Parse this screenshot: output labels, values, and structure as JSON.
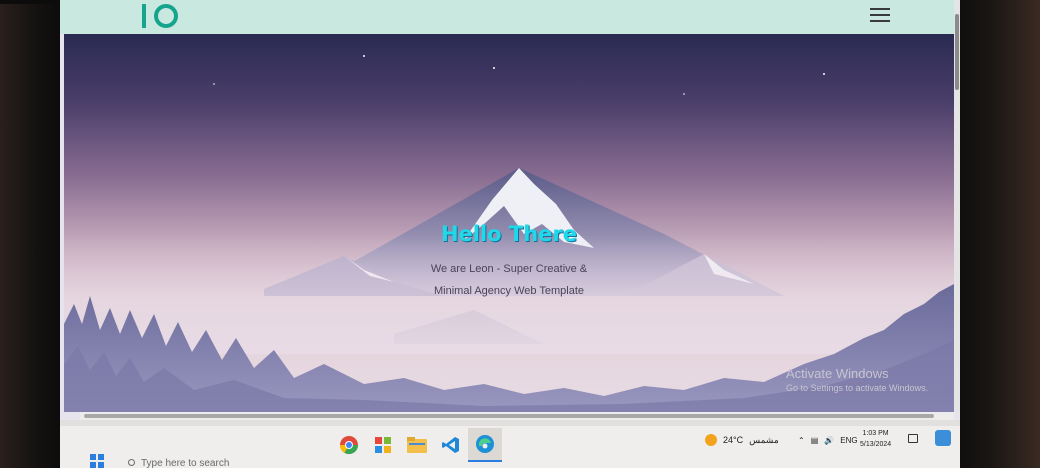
{
  "hero": {
    "title": "Hello There",
    "subtitle_line1": "We are Leon - Super Creative &",
    "subtitle_line2": "Minimal Agency Web Template"
  },
  "watermark": {
    "line1": "Activate Windows",
    "line2": "Go to Settings to activate Windows."
  },
  "taskbar": {
    "search_placeholder": "Type here to search",
    "weather_temp": "24°C",
    "weather_text": "مشمس",
    "language": "ENG",
    "time": "1:03 PM",
    "date": "5/13/2024"
  },
  "colors": {
    "brand_accent": "#14a58c",
    "hero_title": "#1fd8e8",
    "header_bg": "#c8e8e0"
  },
  "icons": [
    "logo",
    "menu-icon",
    "moon",
    "chrome-icon",
    "colorful-app-icon",
    "file-explorer-icon",
    "vscode-icon",
    "edge-icon",
    "weather-sun-icon",
    "chevron-up-icon",
    "network-icon",
    "volume-icon",
    "notification-icon"
  ]
}
